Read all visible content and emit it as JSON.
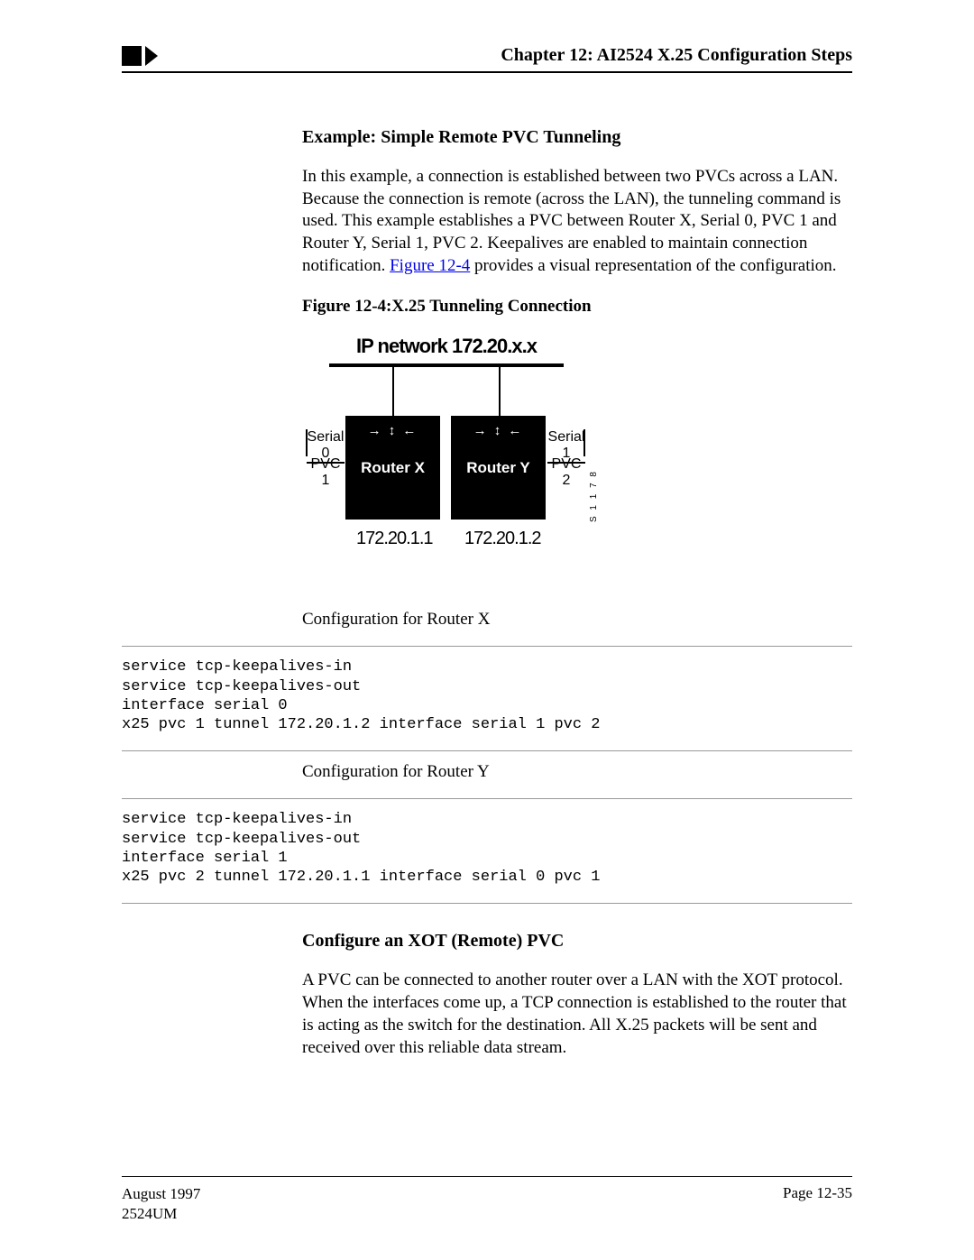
{
  "header": {
    "chapter_title": "Chapter 12: AI2524 X.25 Configuration Steps"
  },
  "section1": {
    "heading": "Example: Simple Remote PVC Tunneling",
    "para_before_link": "In this example, a connection is established between two PVCs across a LAN. Because the connection is remote (across the LAN), the tunneling command is used. This example establishes a PVC between Router X, Serial 0, PVC 1 and Router Y, Serial 1, PVC 2. Keepalives are enabled to maintain connection notification. ",
    "link_text": "Figure 12-4",
    "para_after_link": " provides a visual representation of the configuration."
  },
  "figure": {
    "caption": "Figure 12-4:X.25 Tunneling Connection",
    "ip_network": "IP network 172.20.x.x",
    "router_x": "Router X",
    "router_y": "Router Y",
    "serial0": "Serial 0",
    "pvc1": "PVC 1",
    "serial1": "Serial 1",
    "pvc2": "PVC 2",
    "ip_x": "172.20.1.1",
    "ip_y": "172.20.1.2",
    "side_num": "S 1 1 7 8"
  },
  "config_x": {
    "label": "Configuration for Router X",
    "code": "service tcp-keepalives-in\nservice tcp-keepalives-out\ninterface serial 0\nx25 pvc 1 tunnel 172.20.1.2 interface serial 1 pvc 2"
  },
  "config_y": {
    "label": "Configuration for Router Y",
    "code": "service tcp-keepalives-in\nservice tcp-keepalives-out\ninterface serial 1\nx25 pvc 2 tunnel 172.20.1.1 interface serial 0 pvc 1"
  },
  "section2": {
    "heading": "Configure an XOT (Remote) PVC",
    "para": "A PVC can be connected to another router over a LAN with the XOT protocol. When the interfaces come up, a TCP connection is established to the router that is acting as the switch for the destination. All X.25 packets will be sent and received over this reliable data stream."
  },
  "footer": {
    "date": "August 1997",
    "doc": "2524UM",
    "page": "Page 12-35"
  }
}
